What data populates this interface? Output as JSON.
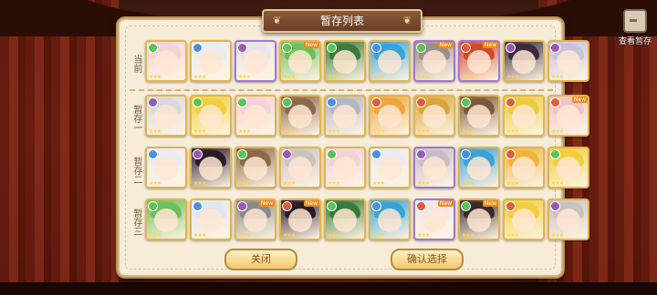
{
  "title": "暂存列表",
  "top_right_button": "查看暂存",
  "rows": [
    {
      "label": "当前",
      "cards": [
        {
          "hair": "#f4d3d7",
          "elem": "#5cc25a",
          "border": "gold",
          "new": false
        },
        {
          "hair": "#ebebf2",
          "elem": "#4a90e2",
          "border": "gold",
          "new": false
        },
        {
          "hair": "#e6e6ea",
          "elem": "#9b59b6",
          "border": "purple",
          "new": false
        },
        {
          "hair": "#6dbf5a",
          "elem": "#5cc25a",
          "border": "gold",
          "new": true
        },
        {
          "hair": "#3b7a3a",
          "elem": "#5cc25a",
          "border": "gold",
          "new": false
        },
        {
          "hair": "#3aa3d6",
          "elem": "#4a90e2",
          "border": "gold",
          "new": false
        },
        {
          "hair": "#9a8f86",
          "elem": "#5cc25a",
          "border": "purple",
          "new": true
        },
        {
          "hair": "#d24a2a",
          "elem": "#e25b3a",
          "border": "purple",
          "new": true
        },
        {
          "hair": "#3a2a3a",
          "elem": "#9b59b6",
          "border": "gold",
          "new": false
        },
        {
          "hair": "#c9c3da",
          "elem": "#9b59b6",
          "border": "gold",
          "new": false
        }
      ]
    },
    {
      "label": "暂存一",
      "cards": [
        {
          "hair": "#d8d8de",
          "elem": "#9b59b6",
          "border": "gold",
          "new": false
        },
        {
          "hair": "#f2cf3a",
          "elem": "#5cc25a",
          "border": "gold",
          "new": false
        },
        {
          "hair": "#f4d3d7",
          "elem": "#5cc25a",
          "border": "gold",
          "new": false
        },
        {
          "hair": "#8a6a4a",
          "elem": "#5cc25a",
          "border": "gold",
          "new": false
        },
        {
          "hair": "#b3b8c0",
          "elem": "#4a90e2",
          "border": "gold",
          "new": false
        },
        {
          "hair": "#f1a43a",
          "elem": "#e25b3a",
          "border": "gold",
          "new": false
        },
        {
          "hair": "#d9a53a",
          "elem": "#e25b3a",
          "border": "gold",
          "new": false
        },
        {
          "hair": "#7a5a3a",
          "elem": "#5cc25a",
          "border": "gold",
          "new": false
        },
        {
          "hair": "#eccc3a",
          "elem": "#e25b3a",
          "border": "gold",
          "new": false
        },
        {
          "hair": "#f1c4c8",
          "elem": "#e25b3a",
          "border": "gold",
          "new": true
        }
      ]
    },
    {
      "label": "暂存二",
      "cards": [
        {
          "hair": "#ebebf2",
          "elem": "#4a90e2",
          "border": "gold",
          "new": false
        },
        {
          "hair": "#2a1a2a",
          "elem": "#9b59b6",
          "border": "gold",
          "new": false
        },
        {
          "hair": "#8a6a4a",
          "elem": "#5cc25a",
          "border": "gold",
          "new": false
        },
        {
          "hair": "#c9c3c0",
          "elem": "#9b59b6",
          "border": "gold",
          "new": false
        },
        {
          "hair": "#f4d3d7",
          "elem": "#5cc25a",
          "border": "gold",
          "new": false
        },
        {
          "hair": "#ebebf2",
          "elem": "#4a90e2",
          "border": "gold",
          "new": false
        },
        {
          "hair": "#c8bcc8",
          "elem": "#9b59b6",
          "border": "purple",
          "new": false
        },
        {
          "hair": "#3aa3d6",
          "elem": "#4a90e2",
          "border": "gold",
          "new": false
        },
        {
          "hair": "#f0b43a",
          "elem": "#e25b3a",
          "border": "gold",
          "new": false
        },
        {
          "hair": "#f2cf3a",
          "elem": "#5cc25a",
          "border": "gold",
          "new": false
        }
      ]
    },
    {
      "label": "暂存三",
      "cards": [
        {
          "hair": "#6dbf5a",
          "elem": "#5cc25a",
          "border": "gold",
          "new": false
        },
        {
          "hair": "#dfe6f0",
          "elem": "#4a90e2",
          "border": "gold",
          "new": false
        },
        {
          "hair": "#8a8a8a",
          "elem": "#9b59b6",
          "border": "gold",
          "new": true
        },
        {
          "hair": "#2a1a2a",
          "elem": "#e25b3a",
          "border": "gold",
          "new": true
        },
        {
          "hair": "#3b7a3a",
          "elem": "#5cc25a",
          "border": "gold",
          "new": false
        },
        {
          "hair": "#3aa3d6",
          "elem": "#4a90e2",
          "border": "gold",
          "new": false
        },
        {
          "hair": "#f0e8e8",
          "elem": "#e25b3a",
          "border": "purple",
          "new": true
        },
        {
          "hair": "#3a2a2a",
          "elem": "#5cc25a",
          "border": "gold",
          "new": true
        },
        {
          "hair": "#f2cf3a",
          "elem": "#e25b3a",
          "border": "gold",
          "new": false
        },
        {
          "hair": "#c7c3be",
          "elem": "#9b59b6",
          "border": "gold",
          "new": false
        }
      ]
    }
  ],
  "new_badge": "New",
  "stars": "★★★",
  "buttons": {
    "close": "关闭",
    "confirm": "确认选择"
  }
}
